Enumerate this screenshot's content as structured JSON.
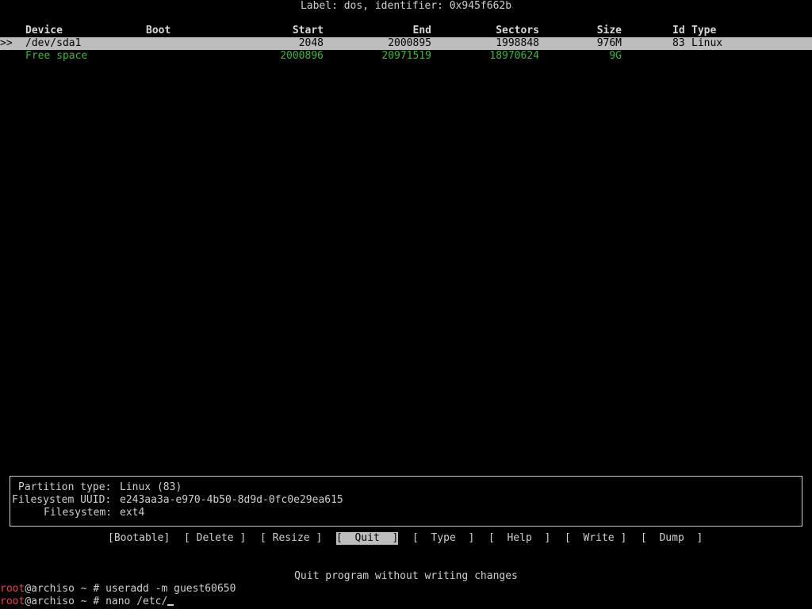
{
  "header": {
    "label": "Label: dos, identifier: 0x945f662b"
  },
  "table": {
    "columns": {
      "device": "Device",
      "boot": "Boot",
      "start": "Start",
      "end": "End",
      "sectors": "Sectors",
      "size": "Size",
      "id": "Id",
      "type": "Type"
    },
    "rows": [
      {
        "marker": ">>",
        "device": "/dev/sda1",
        "boot": "",
        "start": "2048",
        "end": "2000895",
        "sectors": "1998848",
        "size": "976M",
        "id": "83",
        "type": "Linux"
      },
      {
        "marker": "",
        "device": "Free space",
        "boot": "",
        "start": "2000896",
        "end": "20971519",
        "sectors": "18970624",
        "size": "9G",
        "id": "",
        "type": ""
      }
    ]
  },
  "info": {
    "partition_type_label": "Partition type:",
    "partition_type_value": "Linux (83)",
    "uuid_label": "Filesystem UUID:",
    "uuid_value": "e243aa3a-e970-4b50-8d9d-0fc0e29ea615",
    "filesystem_label": "Filesystem:",
    "filesystem_value": "ext4"
  },
  "menu": {
    "bootable": "[Bootable]",
    "delete": "[ Delete ]",
    "resize": "[ Resize ]",
    "quit": "[  Quit  ]",
    "type": "[  Type  ]",
    "help": "[  Help  ]",
    "write": "[  Write ]",
    "dump": "[  Dump  ]"
  },
  "hint": "Quit program without writing changes",
  "terminal": {
    "lines": [
      {
        "user": "root",
        "host": "@archiso ~ # ",
        "command": "useradd -m guest60650"
      },
      {
        "user": "root",
        "host": "@archiso ~ # ",
        "command": "nano /etc/"
      }
    ]
  },
  "colors": {
    "background": "#000000",
    "text": "#cfcfcf",
    "selection": "#bdbdbd",
    "free_space": "#3fb33f",
    "prompt_user": "#e04848"
  }
}
